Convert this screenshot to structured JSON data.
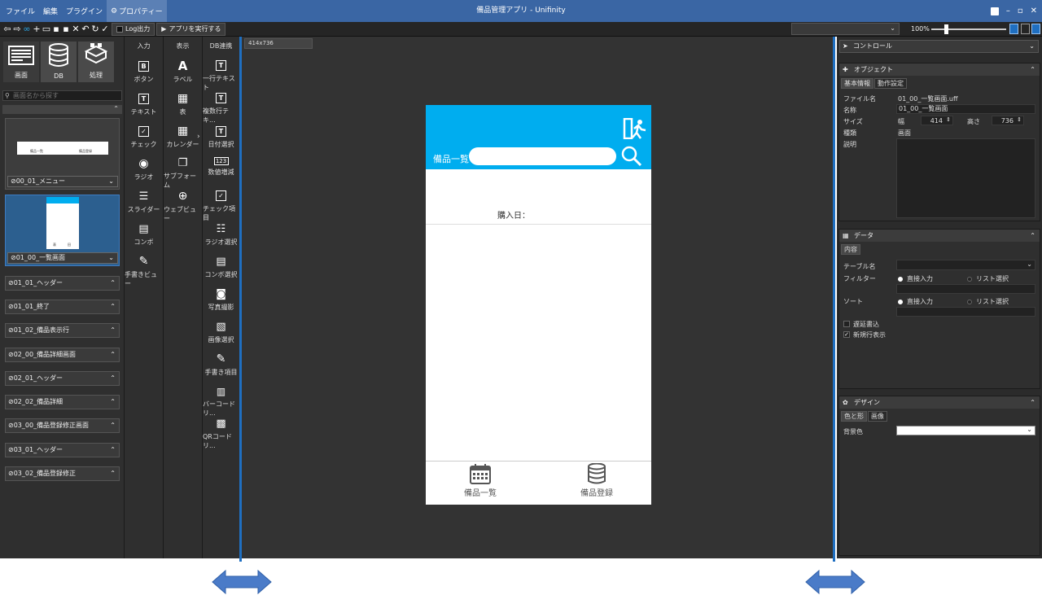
{
  "titlebar": {
    "menu": [
      "ファイル",
      "編集",
      "プラグイン",
      "プロパティー"
    ],
    "app_title": "備品管理アプリ - Unifinity"
  },
  "toolbar": {
    "log_label": "Log出力",
    "run_label": "アプリを実行する",
    "zoom": "100%"
  },
  "left": {
    "categories": [
      "画面",
      "DB",
      "処理"
    ],
    "search_placeholder": "画面名から探す",
    "thumbnails": [
      {
        "label": "00_01_メニュー",
        "tab1": "備品一覧",
        "tab2": "備品登録"
      },
      {
        "label": "01_00_一覧画面",
        "tab1": "表",
        "tab2": "田"
      }
    ],
    "items": [
      "01_01_ヘッダー",
      "01_01_終了",
      "01_02_備品表示行",
      "02_00_備品詳細画面",
      "02_01_ヘッダー",
      "02_02_備品詳細",
      "03_00_備品登録修正画面",
      "03_01_ヘッダー",
      "03_02_備品登録修正"
    ]
  },
  "palette": {
    "input": {
      "header": "入力",
      "items": [
        "ボタン",
        "テキスト",
        "チェック",
        "ラジオ",
        "スライダー",
        "コンボ",
        "手書きビュー"
      ]
    },
    "display": {
      "header": "表示",
      "items": [
        "ラベル",
        "表",
        "カレンダー",
        "サブフォーム",
        "ウェブビュー"
      ]
    },
    "db": {
      "header": "DB連携",
      "items": [
        "一行テキスト",
        "複数行テキ...",
        "日付選択",
        "数値増減",
        "チェック項目",
        "ラジオ選択",
        "コンボ選択",
        "写真撮影",
        "画像選択",
        "手書き項目",
        "バーコードリ...",
        "QRコードリ..."
      ]
    }
  },
  "canvas": {
    "tab": "414x736",
    "phone": {
      "header_title": "備品一覧",
      "field_label": "購入日：",
      "footer_tabs": [
        "備品一覧",
        "備品登録"
      ]
    }
  },
  "right": {
    "control_label": "コントロール",
    "object": {
      "title": "オブジェクト",
      "tabs": [
        "基本情報",
        "動作設定"
      ],
      "labels": {
        "file": "ファイル名",
        "name": "名称",
        "size": "サイズ",
        "type": "種類",
        "desc": "説明",
        "width": "幅",
        "height": "高さ"
      },
      "values": {
        "file": "01_00_一覧画面.uff",
        "name": "01_00_一覧画面",
        "width": "414",
        "height": "736",
        "type": "画面"
      }
    },
    "data": {
      "title": "データ",
      "tabs": [
        "内容"
      ],
      "labels": {
        "table": "テーブル名",
        "filter": "フィルター",
        "sort": "ソート",
        "direct": "直接入力",
        "list": "リスト選択",
        "lazy": "遅延書込",
        "newrow": "新規行表示"
      },
      "lazy_checked": false,
      "newrow_checked": true
    },
    "design": {
      "title": "デザイン",
      "tabs": [
        "色と形",
        "画像"
      ],
      "labels": {
        "bg": "背景色"
      }
    }
  },
  "colors": {
    "accent": "#00adef",
    "titlebar": "#3a66a4",
    "splitter": "#1f6fc1"
  }
}
